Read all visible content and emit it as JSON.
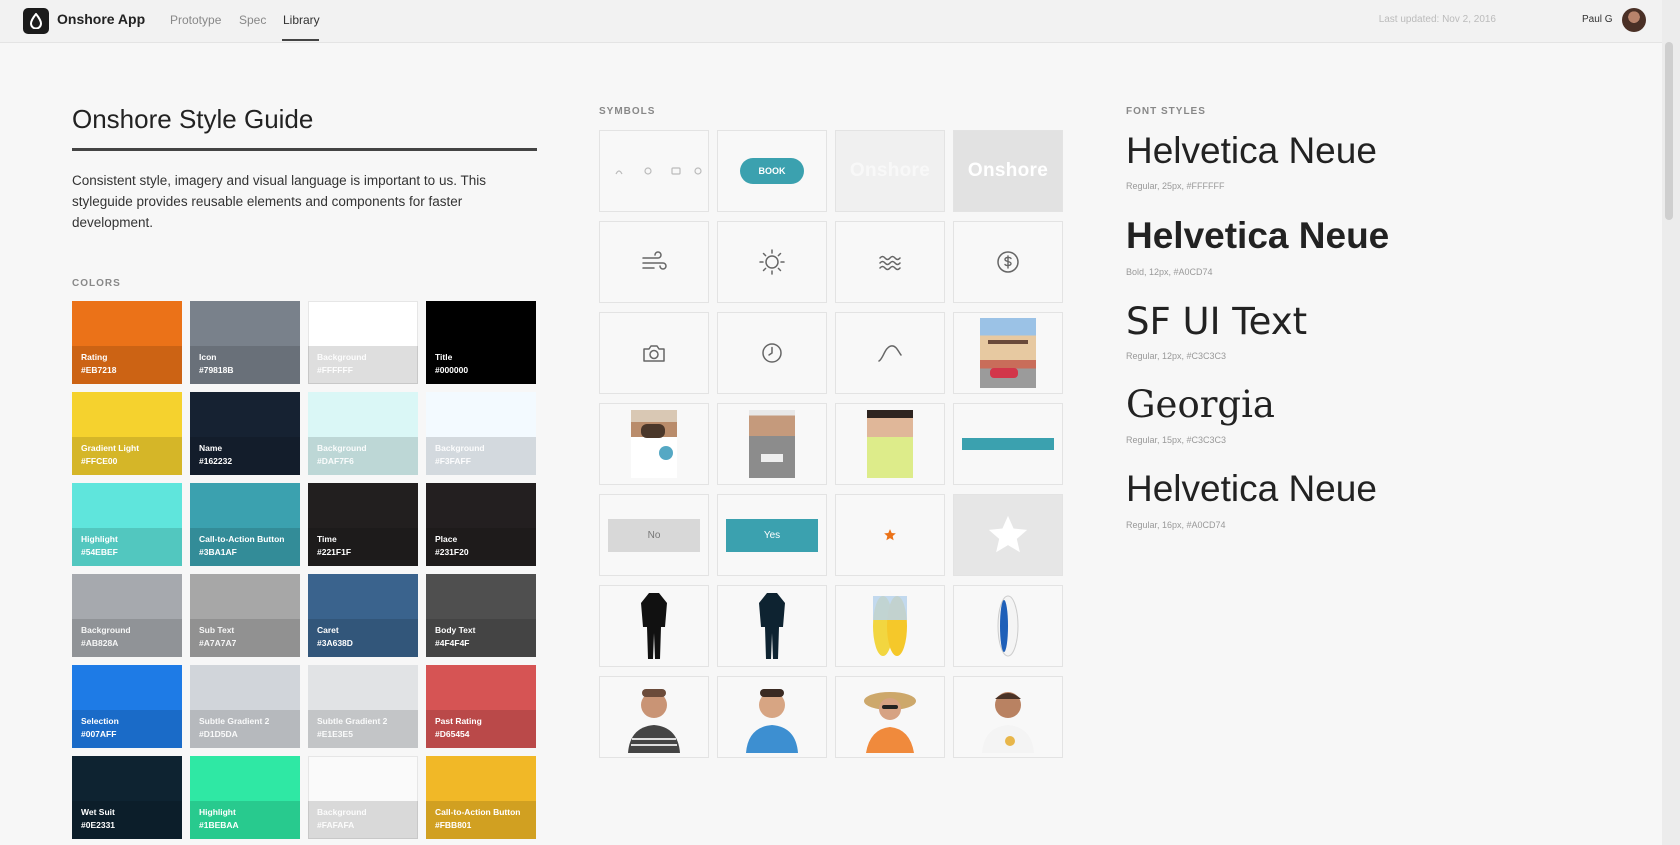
{
  "app": {
    "title": "Onshore App"
  },
  "nav": {
    "items": [
      "Prototype",
      "Spec",
      "Library"
    ],
    "active": "Library"
  },
  "header": {
    "last_updated": "Last updated: Nov 2, 2016",
    "user": "Paul G"
  },
  "page": {
    "title": "Onshore Style Guide",
    "intro": "Consistent style, imagery and visual language is important to us. This styleguide provides reusable elements and components for faster development."
  },
  "colors": {
    "label": "COLORS",
    "items": [
      {
        "name": "Rating",
        "hex": "#EB7218",
        "value": "#EB7218"
      },
      {
        "name": "Icon",
        "hex": "#79818B",
        "value": "#79818B"
      },
      {
        "name": "Background",
        "hex": "#FFFFFF",
        "value": "#FFFFFF"
      },
      {
        "name": "Title",
        "hex": "#000000",
        "value": "#000000"
      },
      {
        "name": "Gradient Light",
        "hex": "#FFCE00",
        "value": "#F5D22E"
      },
      {
        "name": "Name",
        "hex": "#162232",
        "value": "#162232"
      },
      {
        "name": "Background",
        "hex": "#DAF7F6",
        "value": "#DAF7F6"
      },
      {
        "name": "Background",
        "hex": "#F3FAFF",
        "value": "#F3FAFF"
      },
      {
        "name": "Highlight",
        "hex": "#54EBEF",
        "value": "#5FE5DC"
      },
      {
        "name": "Call-to-Action Button",
        "hex": "#3BA1AF",
        "value": "#3BA1AF"
      },
      {
        "name": "Time",
        "hex": "#221F1F",
        "value": "#221F1F"
      },
      {
        "name": "Place",
        "hex": "#231F20",
        "value": "#231F20"
      },
      {
        "name": "Background",
        "hex": "#AB828A",
        "value": "#A6A9AE"
      },
      {
        "name": "Sub Text",
        "hex": "#A7A7A7",
        "value": "#A7A7A7"
      },
      {
        "name": "Caret",
        "hex": "#3A638D",
        "value": "#3A638D"
      },
      {
        "name": "Body Text",
        "hex": "#4F4F4F",
        "value": "#4F4F4F"
      },
      {
        "name": "Selection",
        "hex": "#007AFF",
        "value": "#1E7BE6"
      },
      {
        "name": "Subtle Gradient 2",
        "hex": "#D1D5DA",
        "value": "#D1D5DA"
      },
      {
        "name": "Subtle Gradient 2",
        "hex": "#E1E3E5",
        "value": "#E1E3E5"
      },
      {
        "name": "Past Rating",
        "hex": "#D65454",
        "value": "#D65454"
      },
      {
        "name": "Wet Suit",
        "hex": "#0E2331",
        "value": "#0E2331"
      },
      {
        "name": "Highlight",
        "hex": "#1BEBAA",
        "value": "#2FE8A4"
      },
      {
        "name": "Background",
        "hex": "#FAFAFA",
        "value": "#FAFAFA"
      },
      {
        "name": "Call-to-Action Button",
        "hex": "#FBB801",
        "value": "#F1B827"
      }
    ]
  },
  "symbols": {
    "label": "SYMBOLS",
    "book_label": "BOOK",
    "logo_word": "Onshore",
    "no_label": "No",
    "yes_label": "Yes"
  },
  "fonts": {
    "label": "FONT STYLES",
    "items": [
      {
        "sample": "Helvetica Neue",
        "meta": "Regular, 25px, #FFFFFF"
      },
      {
        "sample": "Helvetica Neue",
        "meta": "Bold, 12px, #A0CD74"
      },
      {
        "sample": "SF UI Text",
        "meta": "Regular, 12px, #C3C3C3"
      },
      {
        "sample": "Georgia",
        "meta": "Regular, 15px, #C3C3C3"
      },
      {
        "sample": "Helvetica Neue",
        "meta": "Regular, 16px, #A0CD74"
      }
    ]
  }
}
